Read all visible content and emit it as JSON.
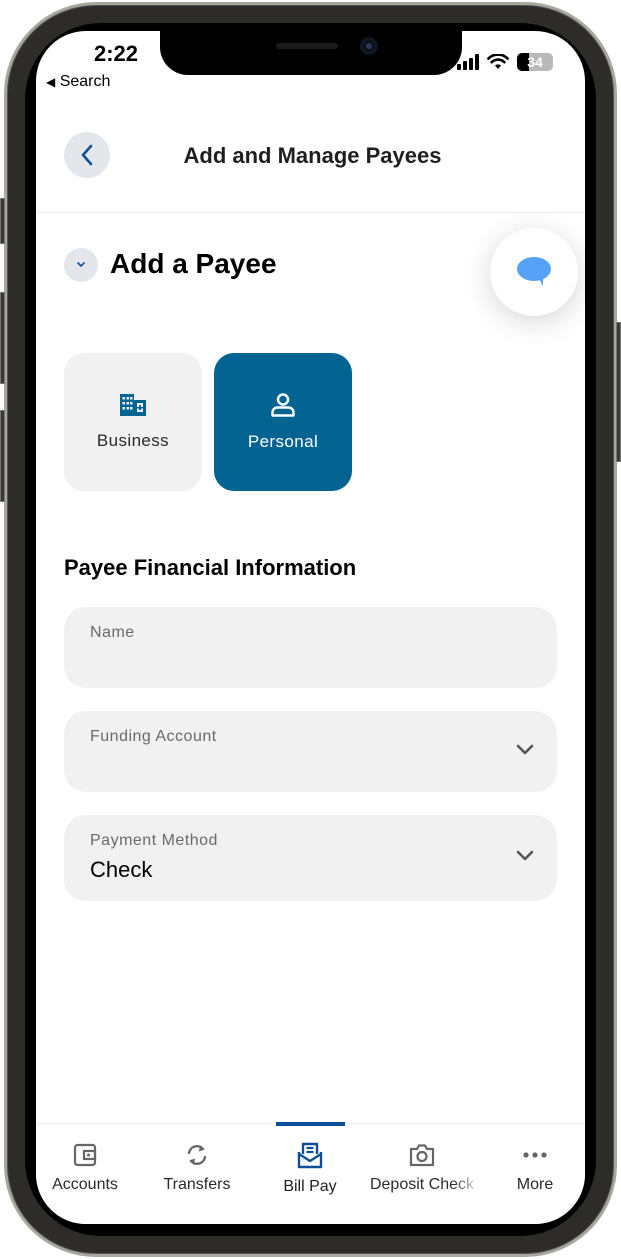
{
  "status_bar": {
    "time": "2:22",
    "back_label": "Search",
    "back_icon": "left-triangle-icon",
    "battery": "34",
    "icons": [
      "cellular-signal-icon",
      "wifi-icon",
      "battery-icon"
    ]
  },
  "header": {
    "title": "Add and Manage Payees",
    "back_icon": "chevron-left-icon"
  },
  "section": {
    "title": "Add a Payee",
    "collapse_icon": "chevron-down-icon",
    "chat_icon": "chat-bubble-icon"
  },
  "payee_types": [
    {
      "label": "Business",
      "icon": "building-icon",
      "selected": false
    },
    {
      "label": "Personal",
      "icon": "person-icon",
      "selected": true
    }
  ],
  "form": {
    "title": "Payee Financial Information",
    "fields": [
      {
        "label": "Name",
        "value": "",
        "type": "text"
      },
      {
        "label": "Funding Account",
        "value": "",
        "type": "select"
      },
      {
        "label": "Payment Method",
        "value": "Check",
        "type": "select"
      }
    ]
  },
  "tabbar": {
    "active_index": 2,
    "items": [
      {
        "label": "Accounts",
        "icon": "wallet-icon"
      },
      {
        "label": "Transfers",
        "icon": "transfer-arrows-icon"
      },
      {
        "label": "Bill Pay",
        "icon": "bill-envelope-icon"
      },
      {
        "label": "Deposit Check",
        "icon": "camera-icon"
      },
      {
        "label": "More",
        "icon": "more-dots-icon"
      }
    ]
  },
  "colors": {
    "primary": "#036491",
    "accent_nav": "#0c4f98",
    "chat": "#55a2f8",
    "field_bg": "#f1f1f1"
  }
}
